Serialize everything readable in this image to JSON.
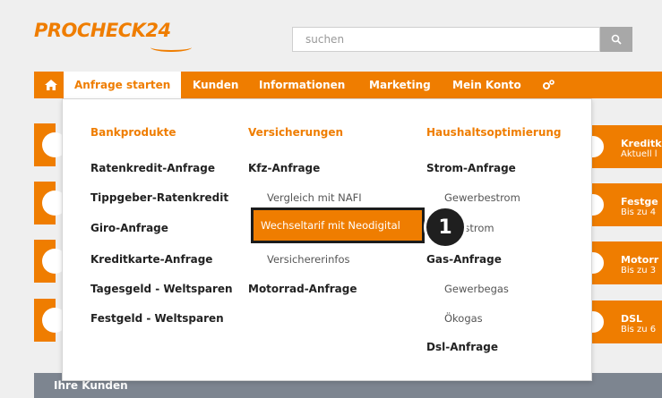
{
  "brand": {
    "logo_text": "PROCHECK24"
  },
  "search": {
    "placeholder": "suchen"
  },
  "nav": {
    "items": [
      "Anfrage starten",
      "Kunden",
      "Informationen",
      "Marketing",
      "Mein Konto"
    ]
  },
  "dropdown": {
    "columns": [
      {
        "heading": "Bankprodukte",
        "entries": [
          "Ratenkredit-Anfrage",
          "Tippgeber-Ratenkredit",
          "Giro-Anfrage",
          "Kreditkarte-Anfrage",
          "Tagesgeld - Weltsparen",
          "Festgeld - Weltsparen"
        ]
      },
      {
        "heading": "Versicherungen",
        "entries": [
          "Kfz-Anfrage",
          "Vergleich mit NAFI",
          "Wechseltarif mit Neodigital",
          "Versichererinfos",
          "Motorrad-Anfrage"
        ]
      },
      {
        "heading": "Haushaltsoptimierung",
        "entries": [
          "Strom-Anfrage",
          "Gewerbestrom",
          "Ökostrom",
          "Gas-Anfrage",
          "Gewerbegas",
          "Ökogas",
          "Dsl-Anfrage"
        ]
      }
    ]
  },
  "right_tiles": [
    {
      "title": "Kreditk",
      "subtitle": "Aktuell l"
    },
    {
      "title": "Festge",
      "subtitle": "Bis zu 4"
    },
    {
      "title": "Motorr",
      "subtitle": "Bis zu 3"
    },
    {
      "title": "DSL",
      "subtitle": "Bis zu 6"
    }
  ],
  "section": {
    "title": "Ihre Kunden"
  },
  "marker": {
    "label": "1"
  },
  "colors": {
    "accent": "#ef7d00",
    "bottom_bar": "#7d8590"
  }
}
